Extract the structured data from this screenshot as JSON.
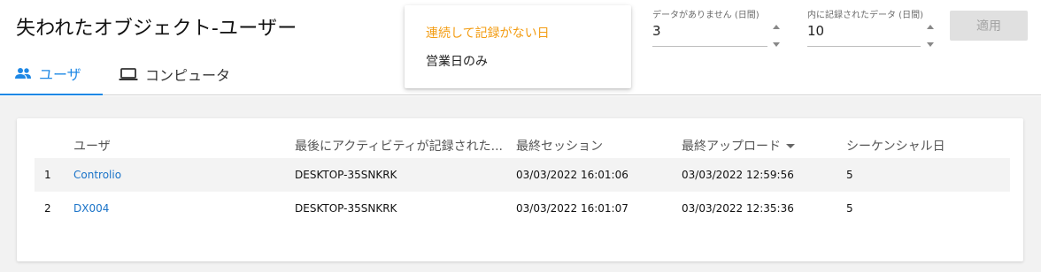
{
  "header": {
    "title": "失われたオブジェクト-ユーザー",
    "tabs": [
      {
        "label": "ユーザ",
        "icon": "people-icon",
        "active": true
      },
      {
        "label": "コンピュータ",
        "icon": "laptop-icon",
        "active": false
      }
    ]
  },
  "dropdown": {
    "options": [
      "連続して記録がない日",
      "営業日のみ"
    ],
    "selected": "連続して記録がない日"
  },
  "filters": {
    "no_data_days": {
      "label": "データがありません (日間)",
      "value": "3"
    },
    "recorded_days": {
      "label": "内に記録されたデータ (日間)",
      "value": "10"
    }
  },
  "apply_button": {
    "label": "適用",
    "enabled": false
  },
  "table": {
    "columns": [
      "",
      "ユーザ",
      "最後にアクティビティが記録されたコンピュータ",
      "最終セッション",
      "最終アップロード",
      "シーケンシャル日"
    ],
    "column_headers_visible": {
      "user": "ユーザ",
      "pc": "最後にアクティビティが記録された...",
      "session": "最終セッション",
      "upload": "最終アップロード",
      "seq": "シーケンシャル日"
    },
    "sort": {
      "column": "最終アップロード",
      "direction": "desc"
    },
    "rows": [
      {
        "num": "1",
        "user": "Controlio",
        "pc": "DESKTOP-35SNKRK",
        "session": "03/03/2022 16:01:06",
        "upload": "03/03/2022 12:59:56",
        "seq": "5"
      },
      {
        "num": "2",
        "user": "DX004",
        "pc": "DESKTOP-35SNKRK",
        "session": "03/03/2022 16:01:07",
        "upload": "03/03/2022 12:35:36",
        "seq": "5"
      }
    ]
  },
  "colors": {
    "accent": "#1e88e5",
    "selected_option": "#f39c12",
    "link": "#1a73c8",
    "disabled_button_bg": "#e0e0e0"
  }
}
